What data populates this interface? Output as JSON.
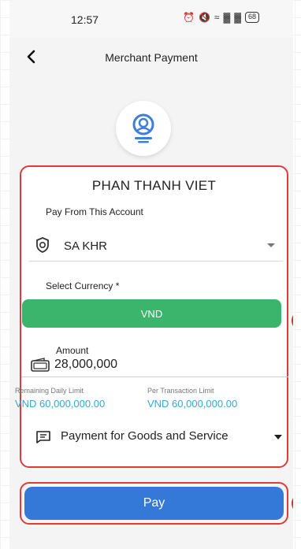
{
  "status_bar": {
    "time": "12:57",
    "battery": "68"
  },
  "header": {
    "title": "Merchant Payment"
  },
  "merchant": {
    "name": "PHAN THANH VIET"
  },
  "form": {
    "pay_from_label": "Pay From This Account",
    "account_value": "SA KHR",
    "currency_label": "Select Currency *",
    "currency_value": "VND",
    "amount_label": "Amount",
    "amount_value": "28,000,000",
    "remaining_daily_limit_label": "Remaining Daily Limit",
    "remaining_daily_limit_value": "VND 60,000,000.00",
    "per_transaction_limit_label": "Per Transaction Limit",
    "per_transaction_limit_value": "VND 60,000,000.00",
    "purpose_value": "Payment for Goods and Service"
  },
  "actions": {
    "pay_label": "Pay"
  },
  "colors": {
    "highlight_border": "#e23a3a",
    "currency_green": "#3bb56b",
    "pay_blue": "#3579d8",
    "limit_blue": "#37a7d6"
  }
}
